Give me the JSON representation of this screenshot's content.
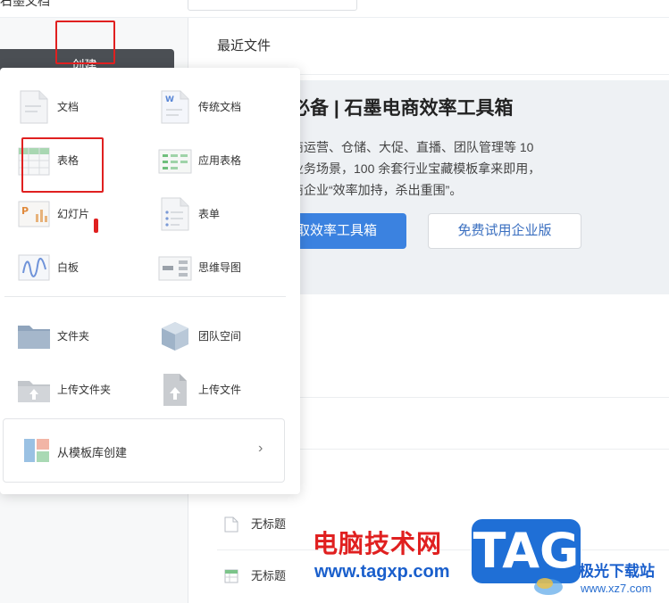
{
  "topbar": {
    "title_fragment": "石墨文档"
  },
  "sidebar": {
    "create_label": "创建"
  },
  "main": {
    "recent_title": "最近文件",
    "banner": {
      "title": "必备 | 石墨电商效率工具箱",
      "desc_line1": "商运营、仓储、大促、直播、团队管理等 10",
      "desc_line2": "业务场景，100 余套行业宝藏模板拿来即用，",
      "desc_line3": "商企业“效率加持，杀出重围”。",
      "primary_label": "取效率工具箱",
      "secondary_label": "免费试用企业版"
    },
    "files": [
      {
        "name": "无标题",
        "icon": "document-icon"
      },
      {
        "name": "无标题",
        "icon": "spreadsheet-icon"
      }
    ]
  },
  "popup": {
    "items": {
      "doc": "文档",
      "legacy_doc": "传统文档",
      "sheet": "表格",
      "app_sheet": "应用表格",
      "slides": "幻灯片",
      "form": "表单",
      "whiteboard": "白板",
      "mindmap": "思维导图",
      "folder": "文件夹",
      "team_space": "团队空间",
      "upload_folder": "上传文件夹",
      "upload_file": "上传文件"
    },
    "template_label": "从模板库创建"
  },
  "watermark": {
    "text": "电脑技术网",
    "url": "www.tagxp.com",
    "tag": "TAG",
    "site": "极光下载站",
    "site_url": "www.xz7.com"
  },
  "colors": {
    "highlight": "#e02020",
    "primary_button": "#3b82e0",
    "create_button": "#4b4f54"
  }
}
